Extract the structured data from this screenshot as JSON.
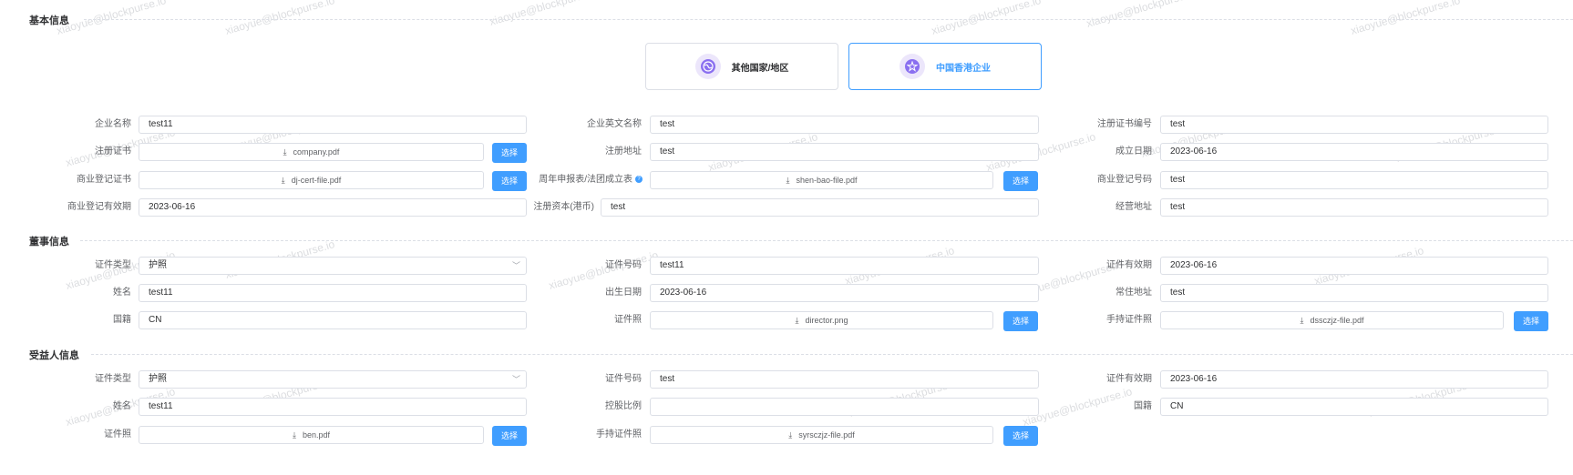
{
  "sections": {
    "basic": "基本信息",
    "director": "董事信息",
    "beneficiary": "受益人信息"
  },
  "types": [
    {
      "label": "其他国家/地区",
      "selected": false
    },
    {
      "label": "中国香港企业",
      "selected": true
    }
  ],
  "basic": {
    "company_name": {
      "label": "企业名称",
      "value": "test11"
    },
    "company_en_name": {
      "label": "企业英文名称",
      "value": "test"
    },
    "reg_cert_no": {
      "label": "注册证书编号",
      "value": "test"
    },
    "reg_cert": {
      "label": "注册证书",
      "file": "company.pdf",
      "button": "选择"
    },
    "reg_address": {
      "label": "注册地址",
      "value": "test"
    },
    "found_date": {
      "label": "成立日期",
      "value": "2023-06-16"
    },
    "biz_reg_cert": {
      "label": "商业登记证书",
      "file": "dj-cert-file.pdf",
      "button": "选择"
    },
    "annual_return": {
      "label": "周年申报表/法团成立表",
      "help": "?",
      "file": "shen-bao-file.pdf",
      "button": "选择"
    },
    "biz_reg_no": {
      "label": "商业登记号码",
      "value": "test"
    },
    "biz_reg_expiry": {
      "label": "商业登记有效期",
      "value": "2023-06-16"
    },
    "reg_capital": {
      "label": "注册资本(港币)",
      "value": "test"
    },
    "biz_address": {
      "label": "经营地址",
      "value": "test"
    }
  },
  "director": {
    "id_type": {
      "label": "证件类型",
      "value": "护照"
    },
    "id_no": {
      "label": "证件号码",
      "value": "test11"
    },
    "id_expiry": {
      "label": "证件有效期",
      "value": "2023-06-16"
    },
    "name": {
      "label": "姓名",
      "value": "test11"
    },
    "birth_date": {
      "label": "出生日期",
      "value": "2023-06-16"
    },
    "residence": {
      "label": "常住地址",
      "value": "test"
    },
    "nationality": {
      "label": "国籍",
      "value": "CN"
    },
    "id_photo": {
      "label": "证件照",
      "file": "director.png",
      "button": "选择"
    },
    "hand_id_photo": {
      "label": "手持证件照",
      "file": "dssczjz-file.pdf",
      "button": "选择"
    }
  },
  "beneficiary": {
    "id_type": {
      "label": "证件类型",
      "value": "护照"
    },
    "id_no": {
      "label": "证件号码",
      "value": "test"
    },
    "id_expiry": {
      "label": "证件有效期",
      "value": "2023-06-16"
    },
    "name": {
      "label": "姓名",
      "value": "test11"
    },
    "share_ratio": {
      "label": "控股比例",
      "value": ""
    },
    "nationality": {
      "label": "国籍",
      "value": "CN"
    },
    "id_photo": {
      "label": "证件照",
      "file": "ben.pdf",
      "button": "选择"
    },
    "hand_id_photo": {
      "label": "手持证件照",
      "file": "syrsczjz-file.pdf",
      "button": "选择"
    }
  },
  "watermark": "xiaoyue@blockpurse.io",
  "colors": {
    "primary": "#409eff",
    "border": "#dcdfe6",
    "icon": "#8a6ff0"
  }
}
